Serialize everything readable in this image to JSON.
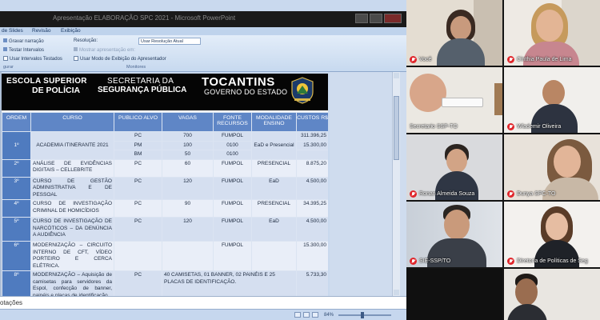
{
  "powerpoint": {
    "window_title": "Apresentação ELABORAÇÃO SPC 2021 - Microsoft PowerPoint",
    "tabs": [
      "de Slides",
      "Revisão",
      "Exibição"
    ],
    "ribbon": {
      "gravar_narracao": "Gravar narração",
      "testar_intervalos": "Testar Intervalos",
      "usar_intervalos": "Usar Intervalos Testados",
      "resolucao_label": "Resolução:",
      "resolucao_value": "Usar Resolução Atual",
      "mostrar_em": "Mostrar apresentação em:",
      "modo_apresentador": "Usar Modo de Exibição do Apresentador",
      "group_configurar": "gurar",
      "group_monitores": "Monitores"
    },
    "slide": {
      "header": {
        "left_line1": "ESCOLA SUPERIOR",
        "left_line2": "DE POLÍCIA",
        "center_line1": "SECRETARIA DA",
        "center_line2": "SEGURANÇA PÚBLICA",
        "right_line1": "TOCANTINS",
        "right_line2": "GOVERNO DO ESTADO"
      },
      "table": {
        "headers": [
          "ORDEM",
          "CURSO",
          "PUBLICO ALVO",
          "VAGAS",
          "FONTE RECURSOS",
          "MODALIDADE ENSINO",
          "CUSTOS R$"
        ],
        "rows": [
          {
            "ordem": "1º",
            "curso": "ACADEMIA ITINERANTE 2021",
            "sub": [
              {
                "publico": "PC",
                "vagas": "700",
                "fonte": "FUMPOL",
                "custo": "311.396,25"
              },
              {
                "publico": "PM",
                "vagas": "100",
                "fonte": "0100",
                "custo": "15.300,00"
              },
              {
                "publico": "BM",
                "vagas": "50",
                "fonte": "0100",
                "custo": ""
              }
            ],
            "modalidade": "EaD e Presencial"
          },
          {
            "ordem": "2º",
            "curso": "ANÁLISE DE EVIDÊNCIAS DIGITAIS – CELLEBRITE",
            "publico": "PC",
            "vagas": "60",
            "fonte": "FUMPOL",
            "modalidade": "PRESENCIAL",
            "custo": "8.875,20"
          },
          {
            "ordem": "3º",
            "curso": "CURSO DE GESTÃO ADMINISTRATIVA E DE PESSOAL",
            "publico": "PC",
            "vagas": "120",
            "fonte": "FUMPOL",
            "modalidade": "EaD",
            "custo": "4.500,00"
          },
          {
            "ordem": "4º",
            "curso": "CURSO DE INVESTIGAÇÃO CRIMINAL DE HOMICÍDIOS",
            "publico": "PC",
            "vagas": "90",
            "fonte": "FUMPOL",
            "modalidade": "PRESENCIAL",
            "custo": "34.395,25"
          },
          {
            "ordem": "5º",
            "curso": "CURSO DE INVESTIGAÇÃO DE NARCÓTICOS – DA DENÚNCIA A AUDIÊNCIA",
            "publico": "PC",
            "vagas": "120",
            "fonte": "FUMPOL",
            "modalidade": "EaD",
            "custo": "4.500,00"
          },
          {
            "ordem": "6º",
            "curso": "MODERNIZAÇÃO – CIRCUITO INTERNO DE CFT, VÍDEO PORTEIRO E CERCA ELÉTRICA.",
            "publico": "",
            "vagas": "",
            "fonte": "FUMPOL",
            "modalidade": "",
            "custo": "15.300,00"
          },
          {
            "ordem": "8º",
            "curso": "MODERNIZAÇÃO – Aquisição de camisetas para servidores da Espol, confecção de banner, painéis e placas de identificação.",
            "publico": "PC",
            "vagas": "40 CAMISETAS, 01 BANNER, 02 PAINÉIS E 25 PLACAS DE IDENTIFICAÇÃO.",
            "fonte": "",
            "modalidade": "",
            "custo": "5.733,30"
          }
        ]
      }
    },
    "notes_label": "otações",
    "zoom": "84%"
  },
  "participants": [
    {
      "name": "Você",
      "muted": true
    },
    {
      "name": "Cinthia Paula de Lima",
      "muted": true
    },
    {
      "name": "Secretario SSP-TO",
      "muted": false
    },
    {
      "name": "Wlademir Oliveira",
      "muted": true
    },
    {
      "name": "Ronan Almeida Souza",
      "muted": true
    },
    {
      "name": "Dunya SPC-TO",
      "muted": true
    },
    {
      "name": "SIE-SSP/TO",
      "muted": true
    },
    {
      "name": "Diretoria de Políticas de Seg",
      "muted": true
    },
    {
      "name": "",
      "muted": false
    },
    {
      "name": "",
      "muted": false
    }
  ],
  "colors": {
    "table_header": "#5f86c6",
    "table_num_col": "#4f7bbf",
    "row_odd": "#d5dff0",
    "row_even": "#e9eef8",
    "muted_mic": "#e0262b"
  }
}
